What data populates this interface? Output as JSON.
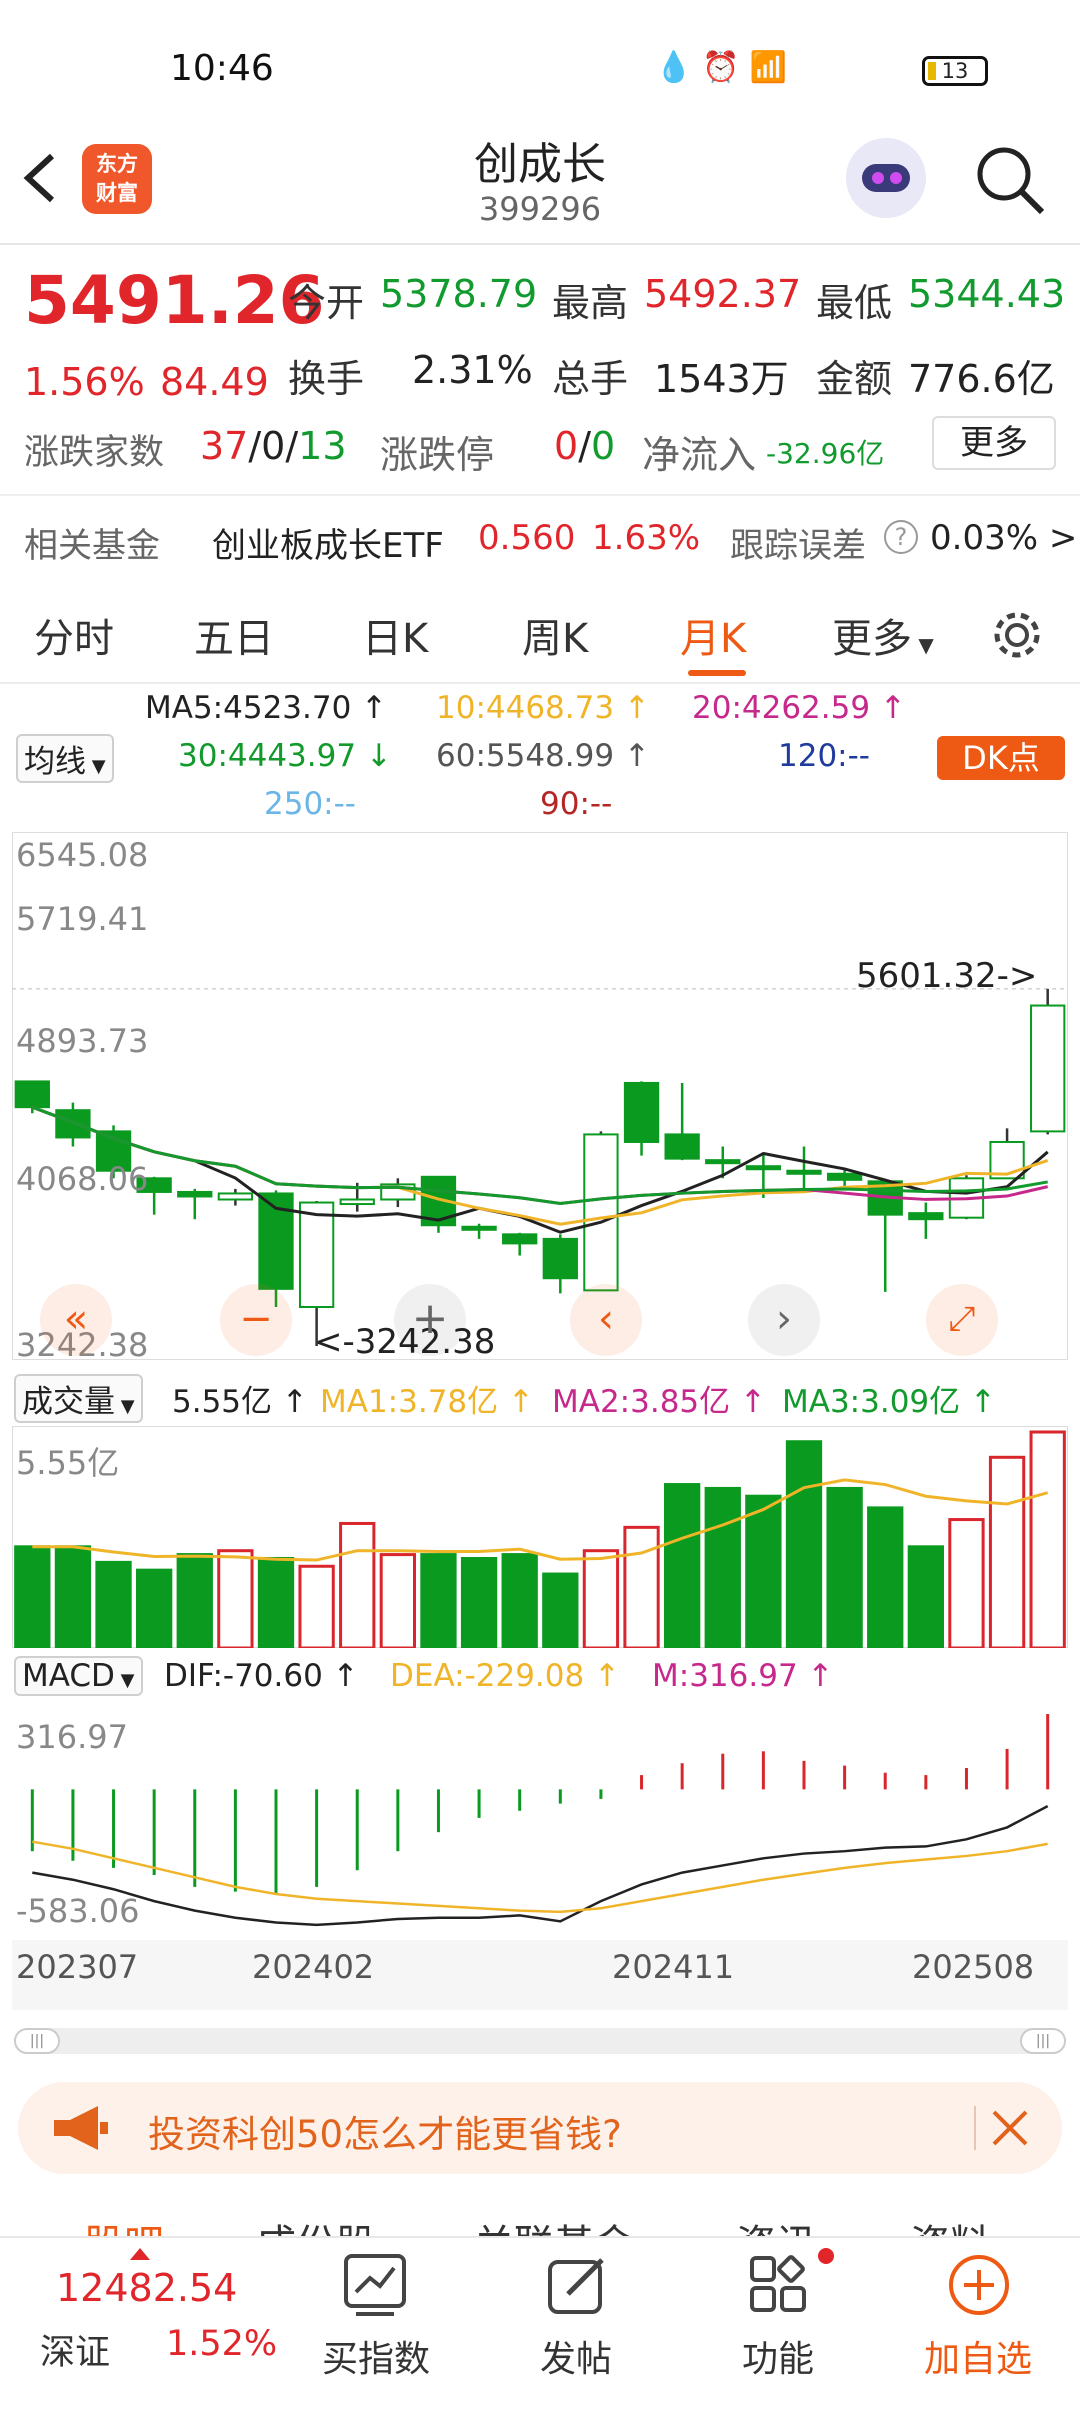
{
  "status": {
    "time": "10:46",
    "battery": "13",
    "icons": [
      "water-drop-icon",
      "alarm-icon",
      "wifi-icon",
      "hd-icon",
      "signal-4g-icon"
    ]
  },
  "header": {
    "back_icon": "chevron-left-icon",
    "logo_text_1": "东方",
    "logo_text_2": "财富",
    "title": "创成长",
    "code": "399296"
  },
  "quote": {
    "price": "5491.26",
    "change_pct": "1.56%",
    "change_amt": "84.49",
    "open_label": "今开",
    "open": "5378.79",
    "high_label": "最高",
    "high": "5492.37",
    "low_label": "最低",
    "low": "5344.43",
    "turnover_label": "换手",
    "turnover": "2.31%",
    "volume_label": "总手",
    "volume": "1543万",
    "amount_label": "金额",
    "amount": "776.6亿",
    "advdec_label": "涨跌家数",
    "adv": "37",
    "sep1": "/",
    "flat": "0",
    "sep2": "/",
    "dec": "13",
    "limit_label": "涨跌停",
    "limit_up": "0",
    "limit_sep": "/",
    "limit_down": "0",
    "netflow_label": "净流入",
    "netflow": "-32.96亿",
    "more_button": "更多"
  },
  "fund": {
    "label": "相关基金",
    "name": "创业板成长ETF",
    "price": "0.560",
    "pct": "1.63%",
    "track_label": "跟踪误差",
    "track_value": "0.03% >"
  },
  "tabs": [
    {
      "label": "分时"
    },
    {
      "label": "五日"
    },
    {
      "label": "日K"
    },
    {
      "label": "周K"
    },
    {
      "label": "月K"
    },
    {
      "label": "更多"
    }
  ],
  "ma_legend": {
    "selector": "均线",
    "ma5": "MA5:4523.70 ↑",
    "ma10": "10:4468.73 ↑",
    "ma20": "20:4262.59 ↑",
    "ma30": "30:4443.97 ↓",
    "ma60": "60:5548.99 ↑",
    "ma120": "120:--",
    "ma250": "250:--",
    "ma90": "90:--",
    "dk_button": "DK点",
    "colors": {
      "ma5": "#222222",
      "ma10": "#f0b429",
      "ma20": "#c6288c",
      "ma30": "#129a2c",
      "ma60": "#555555",
      "ma120": "#1f3b9c",
      "ma250": "#6bb6e6",
      "ma90": "#b42626"
    }
  },
  "chart_labels": {
    "y_high": "6545.08",
    "y_2": "5719.41",
    "y_3": "4893.73",
    "y_4": "4068.06",
    "y_low": "3242.38",
    "max_marker": "5601.32->",
    "min_marker": "<-3242.38",
    "vol_selector": "成交量",
    "vol_value": "5.55亿 ↑",
    "vol_ma1": "MA1:3.78亿 ↑",
    "vol_ma2": "MA2:3.85亿 ↑",
    "vol_ma3": "MA3:3.09亿 ↑",
    "vol_axis": "5.55亿",
    "macd_selector": "MACD",
    "dif": "DIF:-70.60 ↑",
    "dea": "DEA:-229.08 ↑",
    "m": "M:316.97 ↑",
    "macd_high": "316.97",
    "macd_low": "-583.06",
    "x_labels": [
      "202307",
      "202402",
      "202411",
      "202508"
    ]
  },
  "chart_data": {
    "type": "candlestick",
    "period": "monthly",
    "ylim": [
      3242.38,
      6545.08
    ],
    "candles": [
      {
        "o": 4990,
        "c": 4820,
        "h": 4990,
        "l": 4780
      },
      {
        "o": 4800,
        "c": 4620,
        "h": 4850,
        "l": 4560
      },
      {
        "o": 4660,
        "c": 4400,
        "h": 4700,
        "l": 4350
      },
      {
        "o": 4350,
        "c": 4260,
        "h": 4360,
        "l": 4110
      },
      {
        "o": 4260,
        "c": 4230,
        "h": 4280,
        "l": 4080
      },
      {
        "o": 4210,
        "c": 4250,
        "h": 4280,
        "l": 4170
      },
      {
        "o": 4250,
        "c": 3620,
        "h": 4270,
        "l": 3500
      },
      {
        "o": 3500,
        "c": 4190,
        "h": 4200,
        "l": 3242.38
      },
      {
        "o": 4180,
        "c": 4210,
        "h": 4320,
        "l": 4130
      },
      {
        "o": 4210,
        "c": 4310,
        "h": 4350,
        "l": 4160
      },
      {
        "o": 4360,
        "c": 4040,
        "h": 4360,
        "l": 3990
      },
      {
        "o": 4030,
        "c": 4010,
        "h": 4050,
        "l": 3950
      },
      {
        "o": 3980,
        "c": 3920,
        "h": 3990,
        "l": 3840
      },
      {
        "o": 3950,
        "c": 3690,
        "h": 3980,
        "l": 3590
      },
      {
        "o": 3610,
        "c": 4640,
        "h": 4660,
        "l": 3610
      },
      {
        "o": 4980,
        "c": 4590,
        "h": 4990,
        "l": 4500
      },
      {
        "o": 4640,
        "c": 4480,
        "h": 4980,
        "l": 4470
      },
      {
        "o": 4470,
        "c": 4450,
        "h": 4560,
        "l": 4350
      },
      {
        "o": 4430,
        "c": 4410,
        "h": 4520,
        "l": 4220
      },
      {
        "o": 4400,
        "c": 4380,
        "h": 4560,
        "l": 4280
      },
      {
        "o": 4380,
        "c": 4340,
        "h": 4410,
        "l": 4290
      },
      {
        "o": 4330,
        "c": 4110,
        "h": 4330,
        "l": 3600
      },
      {
        "o": 4120,
        "c": 4080,
        "h": 4190,
        "l": 3950
      },
      {
        "o": 4090,
        "c": 4350,
        "h": 4370,
        "l": 4080
      },
      {
        "o": 4350,
        "c": 4590,
        "h": 4680,
        "l": 4350
      },
      {
        "o": 4660,
        "c": 5491.26,
        "h": 5601.32,
        "l": 4640
      }
    ],
    "volume_max": 5.55,
    "volumes": [
      2.6,
      2.6,
      2.2,
      2.0,
      2.4,
      2.5,
      2.3,
      2.1,
      3.2,
      2.4,
      2.4,
      2.3,
      2.4,
      1.9,
      2.5,
      3.1,
      4.2,
      4.1,
      3.9,
      5.3,
      4.1,
      3.6,
      2.6,
      3.3,
      4.9,
      5.55
    ],
    "volume_up": [
      false,
      false,
      false,
      false,
      false,
      true,
      false,
      true,
      true,
      true,
      false,
      false,
      false,
      false,
      true,
      true,
      false,
      false,
      false,
      false,
      false,
      false,
      false,
      true,
      true,
      true
    ],
    "macd_range": [
      -583.06,
      316.97
    ],
    "macd_hist": [
      -260,
      -300,
      -330,
      -360,
      -410,
      -430,
      -440,
      -410,
      -340,
      -260,
      -180,
      -120,
      -90,
      -60,
      -40,
      60,
      110,
      150,
      160,
      120,
      100,
      70,
      60,
      90,
      170,
      316.97
    ],
    "dif": [
      -350,
      -380,
      -420,
      -470,
      -510,
      -540,
      -560,
      -570,
      -560,
      -545,
      -540,
      -540,
      -530,
      -555,
      -470,
      -400,
      -350,
      -320,
      -290,
      -270,
      -260,
      -245,
      -240,
      -210,
      -160,
      -70.6
    ],
    "dea": [
      -220,
      -250,
      -290,
      -330,
      -370,
      -410,
      -440,
      -460,
      -470,
      -480,
      -490,
      -500,
      -510,
      -515,
      -500,
      -470,
      -440,
      -410,
      -380,
      -355,
      -330,
      -310,
      -295,
      -280,
      -260,
      -229.08
    ]
  },
  "banner": {
    "text": "投资科创50怎么才能更省钱?",
    "icon": "megaphone-icon",
    "close_icon": "close-icon"
  },
  "bottom_bar": {
    "index_value": "12482.54",
    "index_name": "深证",
    "index_pct": "1.52%",
    "buy_index": "买指数",
    "post": "发帖",
    "functions": "功能",
    "add_watch": "加自选"
  },
  "peek_tabs": [
    "股吧",
    "成份股",
    "关联基金",
    "资讯",
    "资料"
  ]
}
